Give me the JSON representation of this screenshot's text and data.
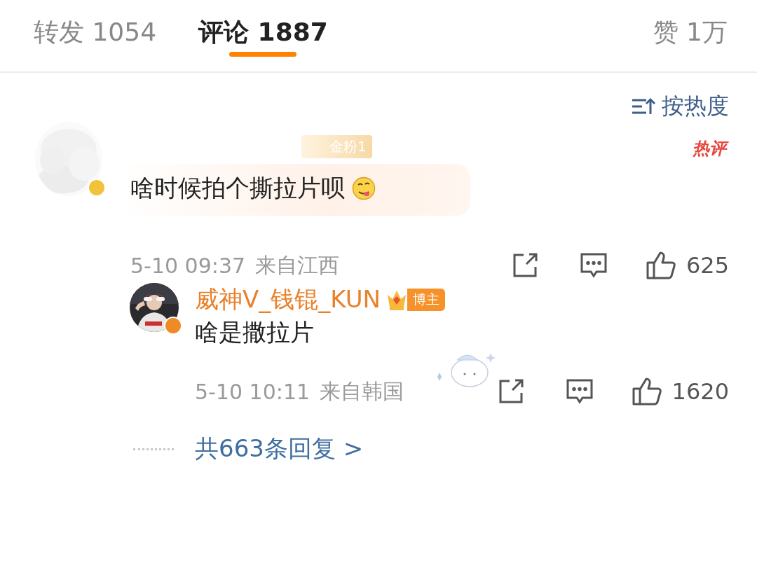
{
  "tabs": [
    {
      "label": "转发",
      "count": "1054",
      "selected": false
    },
    {
      "label": "评论",
      "count": "1887",
      "selected": true
    }
  ],
  "likes_tab": {
    "label": "赞",
    "count": "1万"
  },
  "sort": {
    "label": "按热度"
  },
  "comments": [
    {
      "color": "#f2c23a",
      "fan_badge": "金粉1",
      "hot_label": "热评",
      "text": "啥时候拍个撕拉片呗",
      "time": "5-10 09:37",
      "location": "来自江西",
      "likes": "625",
      "replies": [
        {
          "color": "#f08a24",
          "name": "威神V_钱锟_KUN",
          "role_badge": "博主",
          "text": "啥是撒拉片",
          "time": "5-10 10:11",
          "location": "来自韩国",
          "likes": "1620"
        }
      ],
      "more_replies": "共663条回复 >"
    }
  ]
}
